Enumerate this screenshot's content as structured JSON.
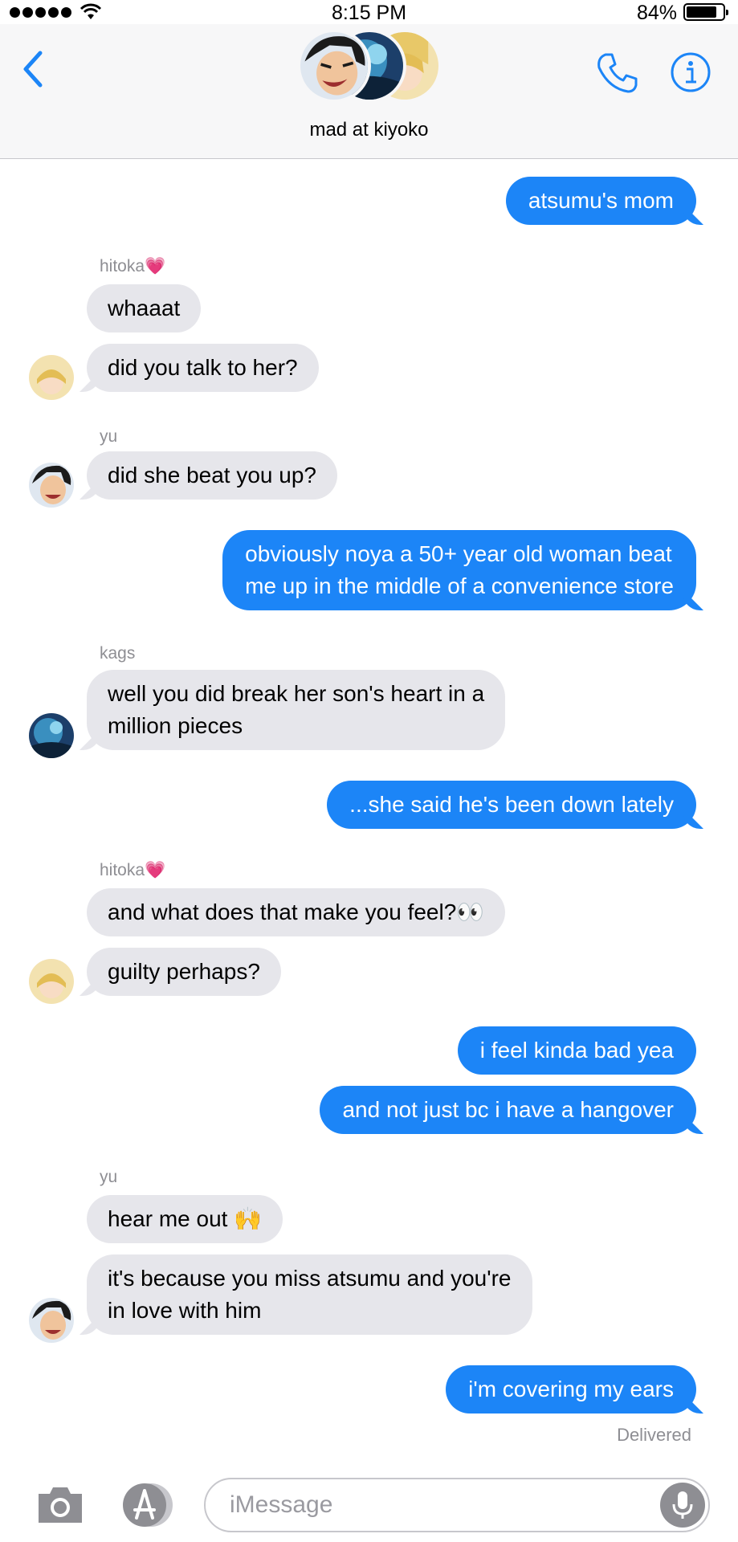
{
  "status_bar": {
    "time": "8:15 PM",
    "battery_percent": "84%",
    "battery_level": 0.84
  },
  "header": {
    "group_name": "mad at kiyoko"
  },
  "messages": [
    {
      "type": "outgoing",
      "text": "atsumu's mom"
    },
    {
      "type": "sender",
      "text": "hitoka💗"
    },
    {
      "type": "incoming",
      "text": "whaaat"
    },
    {
      "type": "incoming",
      "text": "did you talk to her?"
    },
    {
      "type": "sender",
      "text": "yu"
    },
    {
      "type": "incoming",
      "text": "did she beat you up?"
    },
    {
      "type": "outgoing",
      "text": "obviously noya a 50+ year old woman beat"
    },
    {
      "type": "outgoing",
      "text": "me up in the middle of a convenience store"
    },
    {
      "type": "sender",
      "text": "kags"
    },
    {
      "type": "incoming",
      "text": "well you did break her son's heart in a"
    },
    {
      "type": "incoming",
      "text": "million pieces"
    },
    {
      "type": "outgoing",
      "text": "...she said he's been down lately"
    },
    {
      "type": "sender",
      "text": "hitoka💗"
    },
    {
      "type": "incoming",
      "text": "and what does that make you feel?👀"
    },
    {
      "type": "incoming",
      "text": "guilty perhaps?"
    },
    {
      "type": "outgoing",
      "text": "i feel kinda bad yea"
    },
    {
      "type": "outgoing",
      "text": "and not just bc i have a hangover"
    },
    {
      "type": "sender",
      "text": "yu"
    },
    {
      "type": "incoming",
      "text": "hear me out 🙌"
    },
    {
      "type": "incoming",
      "text": "it's because you miss atsumu and you're"
    },
    {
      "type": "incoming",
      "text": "in love with him"
    },
    {
      "type": "outgoing",
      "text": "i'm covering my ears"
    },
    {
      "type": "status",
      "text": "Delivered"
    }
  ],
  "input": {
    "placeholder": "iMessage",
    "value": ""
  },
  "icons": {
    "back": "chevron-left-icon",
    "call": "phone-icon",
    "details": "info-icon",
    "camera": "camera-icon",
    "apps": "app-store-icon",
    "dictation": "microphone-icon"
  },
  "colors": {
    "accent": "#1c85f7",
    "incoming_bubble": "#e6e6eb",
    "secondary_text": "#8e8e93",
    "header_background": "#f7f7f8"
  }
}
